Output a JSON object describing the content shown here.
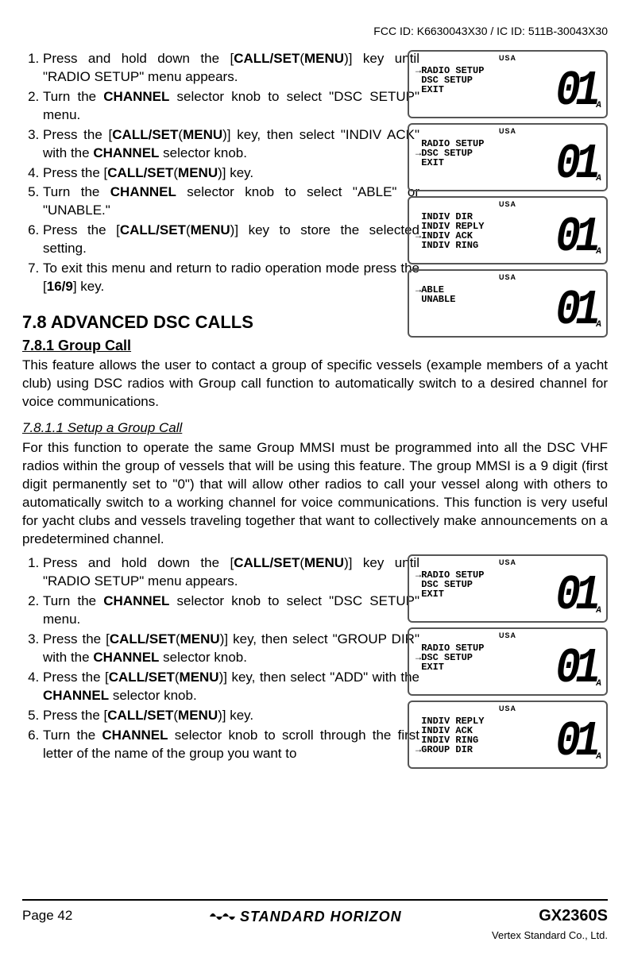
{
  "header": "FCC ID: K6630043X30 / IC ID: 511B-30043X30",
  "list1": [
    {
      "pre": "Press and hold down the [",
      "b1": "CALL/SET",
      "mid": "(",
      "b2": "MENU",
      "post": ")] key until \"RADIO SETUP\" menu appears."
    },
    {
      "pre": "Turn the ",
      "b1": "CHANNEL",
      "post": " selector knob to select \"DSC SETUP\" menu."
    },
    {
      "pre": "Press the [",
      "b1": "CALL/SET",
      "mid": "(",
      "b2": "MENU",
      "post": ")] key, then select \"INDIV ACK\" with the ",
      "b3": "CHANNEL",
      "post2": " selector knob."
    },
    {
      "pre": "Press the [",
      "b1": "CALL/SET",
      "mid": "(",
      "b2": "MENU",
      "post": ")] key."
    },
    {
      "pre": "Turn the ",
      "b1": "CHANNEL",
      "post": " selector knob to select \"ABLE\" or \"UNABLE.\""
    },
    {
      "pre": "Press the [",
      "b1": "CALL/SET",
      "mid": "(",
      "b2": "MENU",
      "post": ")] key to store the selected setting."
    },
    {
      "pre": "To exit this menu and return to radio operation mode press the [",
      "b1": "16/9",
      "post": "] key."
    }
  ],
  "lcd1": [
    {
      "usa": "USA",
      "lines": "→RADIO SETUP\n DSC SETUP\n EXIT",
      "big": "01",
      "a": "A"
    },
    {
      "usa": "USA",
      "lines": " RADIO SETUP\n→DSC SETUP\n EXIT",
      "big": "01",
      "a": "A"
    },
    {
      "usa": "USA",
      "lines": " INDIV DIR\n INDIV REPLY\n→INDIV ACK\n INDIV RING",
      "big": "01",
      "a": "A"
    },
    {
      "usa": "USA",
      "lines": "→ABLE\n UNABLE",
      "big": "01",
      "a": "A"
    }
  ],
  "h2": "7.8  ADVANCED DSC CALLS",
  "h3": "7.8.1  Group Call",
  "p1": "This feature allows the user to contact a group of specific vessels (example members of a yacht club) using DSC radios with Group call function to automatically switch to a desired channel for voice communications.",
  "h4": "7.8.1.1 Setup a Group Call",
  "p2": "For this function to operate the same Group MMSI must be programmed into all the DSC VHF radios within the group of vessels that will be using this feature. The group MMSI is a 9 digit (first digit permanently set to \"0\") that will allow other radios to call your vessel along with others to automatically switch to a working channel for voice communications. This function is very useful for yacht clubs and vessels traveling together that want to collectively make announcements on a predetermined channel.",
  "list2": [
    {
      "pre": "Press and hold down the [",
      "b1": "CALL/SET",
      "mid": "(",
      "b2": "MENU",
      "post": ")] key until \"RADIO SETUP\" menu appears."
    },
    {
      "pre": "Turn the ",
      "b1": "CHANNEL",
      "post": " selector knob to select \"DSC SETUP\" menu."
    },
    {
      "pre": "Press the [",
      "b1": "CALL/SET",
      "mid": "(",
      "b2": "MENU",
      "post": ")] key, then select \"GROUP DIR\" with the ",
      "b3": "CHANNEL",
      "post2": " selector knob."
    },
    {
      "pre": "Press the [",
      "b1": "CALL/SET",
      "mid": "(",
      "b2": "MENU",
      "post": ")] key, then select \"ADD\" with the ",
      "b3": "CHANNEL",
      "post2": " selector knob."
    },
    {
      "pre": "Press the [",
      "b1": "CALL/SET",
      "mid": "(",
      "b2": "MENU",
      "post": ")] key."
    },
    {
      "pre": "Turn the ",
      "b1": "CHANNEL",
      "post": " selector knob to scroll through the first letter of the name of the group you want to"
    }
  ],
  "lcd2": [
    {
      "usa": "USA",
      "lines": "→RADIO SETUP\n DSC SETUP\n EXIT",
      "big": "01",
      "a": "A"
    },
    {
      "usa": "USA",
      "lines": " RADIO SETUP\n→DSC SETUP\n EXIT",
      "big": "01",
      "a": "A"
    },
    {
      "usa": "USA",
      "lines": " INDIV REPLY\n INDIV ACK\n INDIV RING\n→GROUP DIR",
      "big": "01",
      "a": "A"
    }
  ],
  "footer": {
    "page": "Page 42",
    "brand": "STANDARD HORIZON",
    "model": "GX2360S",
    "company": "Vertex Standard Co., Ltd."
  }
}
